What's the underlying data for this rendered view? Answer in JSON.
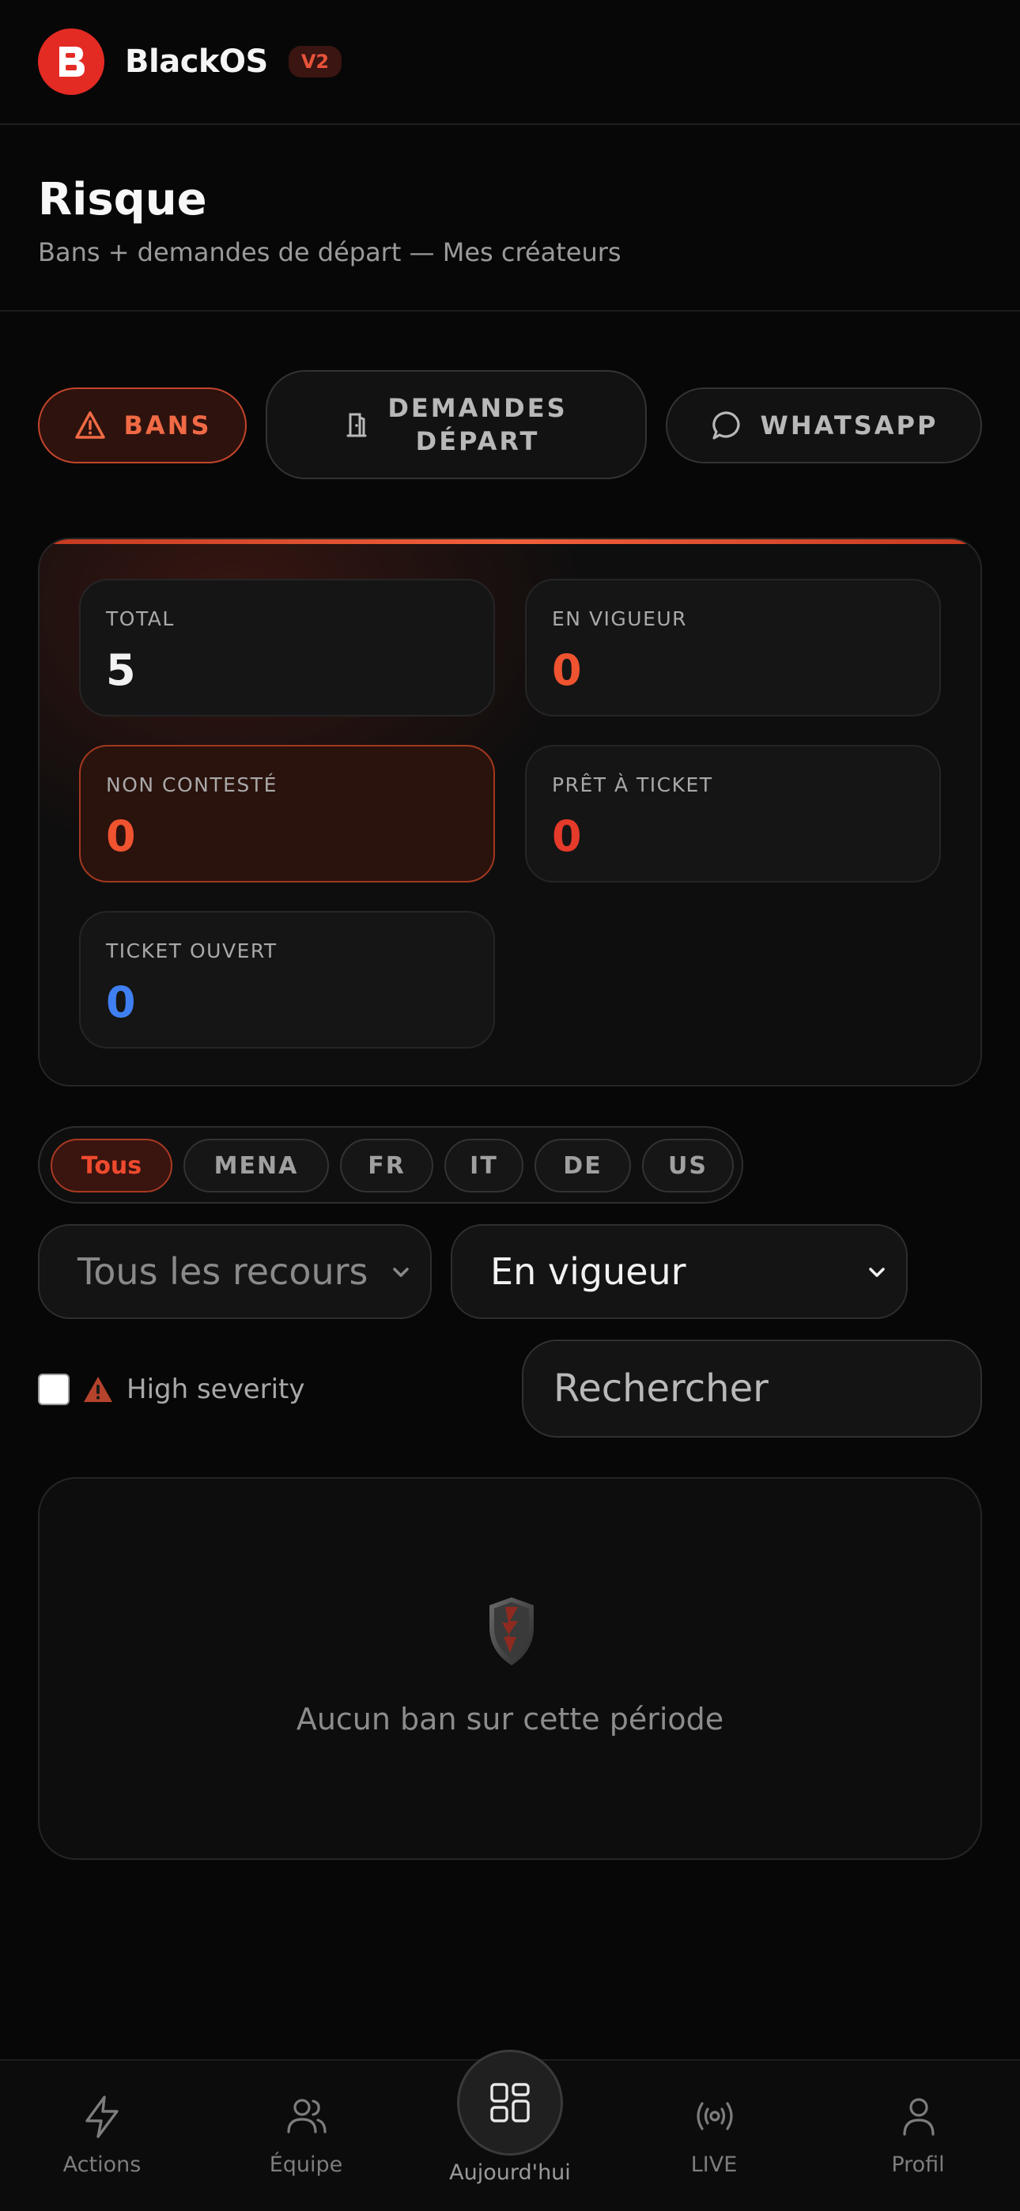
{
  "header": {
    "brand": "BlackOS",
    "version": "V2"
  },
  "page": {
    "title": "Risque",
    "subtitle": "Bans + demandes de départ — Mes créateurs"
  },
  "tabs": [
    {
      "label": "BANS",
      "icon": "warning-icon",
      "active": true
    },
    {
      "label_line1": "DEMANDES",
      "label_line2": "DÉPART",
      "icon": "door-icon"
    },
    {
      "label": "WHATSAPP",
      "icon": "chat-bubble-icon"
    }
  ],
  "stats": [
    {
      "label": "TOTAL",
      "value": "5",
      "color": "#f2f2f2"
    },
    {
      "label": "EN VIGUEUR",
      "value": "0",
      "color": "#ef5330"
    },
    {
      "label": "NON CONTESTÉ",
      "value": "0",
      "color": "#ef5330"
    },
    {
      "label": "PRÊT À TICKET",
      "value": "0",
      "color": "#e63a2a"
    },
    {
      "label": "TICKET OUVERT",
      "value": "0",
      "color": "#3f7ff2"
    }
  ],
  "regions": [
    "Tous",
    "MENA",
    "FR",
    "IT",
    "DE",
    "US"
  ],
  "filters": {
    "recours_selected": "Tous les recours",
    "status_selected": "En vigueur",
    "high_severity_label": "High severity",
    "search_placeholder": "Rechercher"
  },
  "empty": {
    "message": "Aucun ban sur cette période"
  },
  "nav": [
    {
      "label": "Actions",
      "icon": "lightning-icon"
    },
    {
      "label": "Équipe",
      "icon": "team-icon"
    },
    {
      "label": "Aujourd'hui",
      "icon": "grid-icon"
    },
    {
      "label": "LIVE",
      "icon": "broadcast-icon"
    },
    {
      "label": "Profil",
      "icon": "user-icon"
    }
  ],
  "colors": {
    "accent": "#ef5330",
    "background": "#070707"
  }
}
